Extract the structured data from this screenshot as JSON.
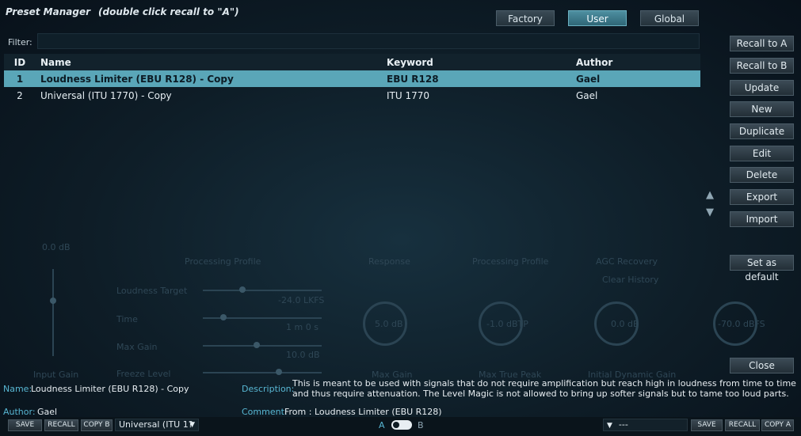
{
  "header": {
    "title": "Preset Manager",
    "hint": "(double click recall to \"A\")"
  },
  "tabs": [
    {
      "label": "Factory",
      "active": false
    },
    {
      "label": "User",
      "active": true
    },
    {
      "label": "Global",
      "active": false
    }
  ],
  "filter": {
    "label": "Filter:",
    "value": ""
  },
  "table": {
    "columns": [
      "ID",
      "Name",
      "Keyword",
      "Author"
    ],
    "rows": [
      {
        "id": "1",
        "name": "Loudness Limiter (EBU R128) - Copy",
        "keyword": "EBU R128",
        "author": "Gael",
        "selected": true
      },
      {
        "id": "2",
        "name": "Universal (ITU 1770) - Copy",
        "keyword": "ITU 1770",
        "author": "Gael",
        "selected": false
      }
    ]
  },
  "side_buttons": [
    "Recall to A",
    "Recall to B",
    "Update",
    "New",
    "Duplicate",
    "Edit",
    "Delete",
    "Export",
    "Import"
  ],
  "set_default_label": "Set as default",
  "close_label": "Close",
  "move_icons": {
    "up": "▲",
    "down": "▼"
  },
  "info": {
    "name_label": "Name:",
    "name_value": "Loudness Limiter (EBU R128) - Copy",
    "author_label": "Author:",
    "author_value": "Gael",
    "description_label": "Description:",
    "description_value": "This is meant to be used with signals that do not require amplification but reach high in loudness from time to time and thus require attenuation. The Level Magic is not allowed to bring up softer signals but to tame too loud parts.",
    "comment_label": "Comment:",
    "comment_value": "From : Loudness Limiter (EBU R128)"
  },
  "bottom": {
    "left": {
      "save": "SAVE",
      "recall": "RECALL",
      "copy": "COPY B",
      "preset": "Universal (ITU 1?"
    },
    "a": "A",
    "b": "B",
    "right": {
      "preset": "---",
      "save": "SAVE",
      "recall": "RECALL",
      "copy": "COPY A"
    }
  },
  "background": {
    "labels": [
      "Processing Profile",
      "Response",
      "Processing Profile",
      "AGC Recovery",
      "Clear History",
      "Loudness Target",
      "Time",
      "Max Gain",
      "Freeze Level",
      "Input Gain",
      "Max Gain",
      "Max True Peak",
      "Initial Dynamic Gain",
      "-24.0 LKFS",
      "1 m 0 s",
      "10.0 dB",
      "5.0 dB",
      "-1.0 dBTP",
      "0.0 dB",
      "-70.0 dBFS",
      "0.0 dB"
    ]
  },
  "colors": {
    "accent": "#5aa6b8",
    "label_blue": "#58b7d3",
    "background": "#0b1620"
  }
}
